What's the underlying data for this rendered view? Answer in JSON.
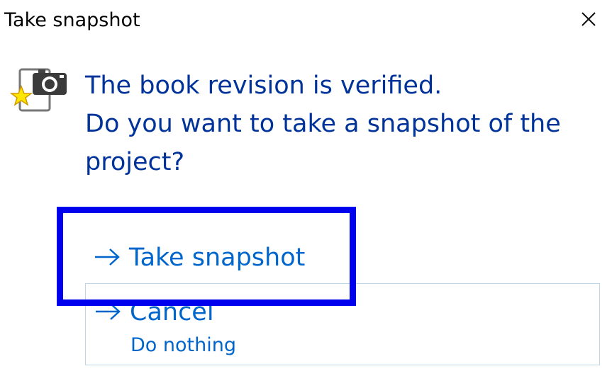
{
  "window": {
    "title": "Take snapshot"
  },
  "icons": {
    "app": "camera-snapshot-icon",
    "close": "close-icon",
    "arrow": "arrow-right-icon"
  },
  "message": {
    "line1": "The book revision is verified.",
    "line2": "Do you want to take a snapshot of the",
    "line3": "project?"
  },
  "commands": [
    {
      "label": "Take snapshot",
      "note": ""
    },
    {
      "label": "Cancel",
      "note": "Do nothing"
    }
  ],
  "colors": {
    "message_text": "#003399",
    "link_text": "#0066cc",
    "focus_frame": "#0000ee",
    "cancel_border": "#bcd6e8"
  }
}
